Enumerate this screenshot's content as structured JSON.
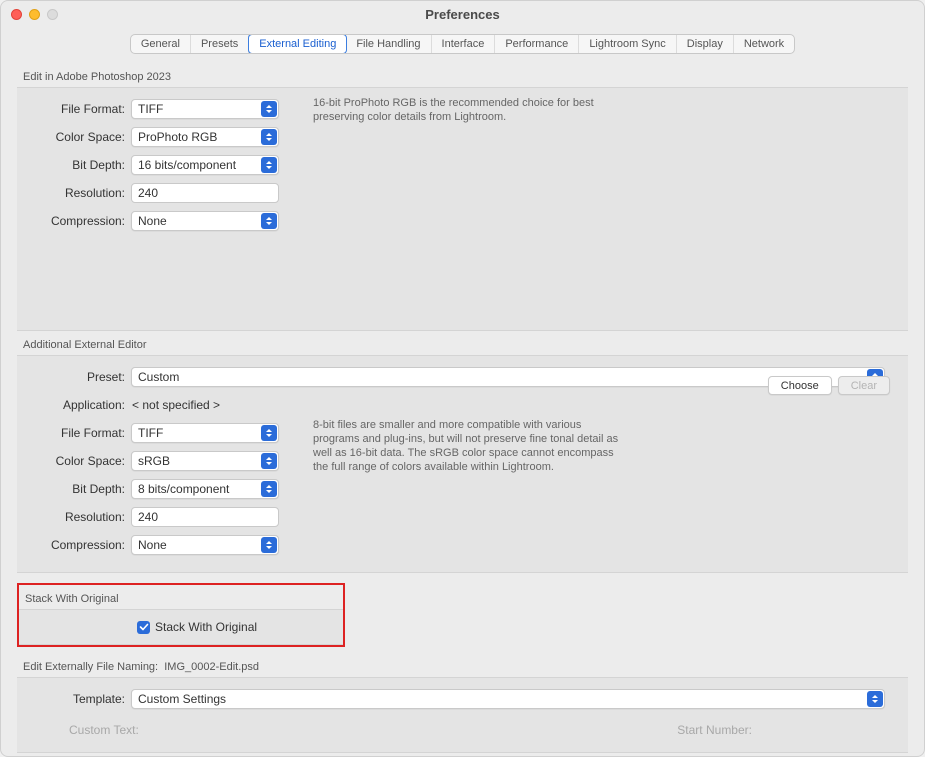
{
  "window": {
    "title": "Preferences"
  },
  "tabs": [
    "General",
    "Presets",
    "External Editing",
    "File Handling",
    "Interface",
    "Performance",
    "Lightroom Sync",
    "Display",
    "Network"
  ],
  "selected_tab_index": 2,
  "section1": {
    "header": "Edit in Adobe Photoshop 2023",
    "file_format": {
      "label": "File Format:",
      "value": "TIFF"
    },
    "color_space": {
      "label": "Color Space:",
      "value": "ProPhoto RGB"
    },
    "bit_depth": {
      "label": "Bit Depth:",
      "value": "16 bits/component"
    },
    "resolution": {
      "label": "Resolution:",
      "value": "240"
    },
    "compression": {
      "label": "Compression:",
      "value": "None"
    },
    "help": "16-bit ProPhoto RGB is the recommended choice for best preserving color details from Lightroom."
  },
  "section2": {
    "header": "Additional External Editor",
    "preset": {
      "label": "Preset:",
      "value": "Custom"
    },
    "application": {
      "label": "Application:",
      "value": "< not specified >"
    },
    "choose_btn": "Choose",
    "clear_btn": "Clear",
    "file_format": {
      "label": "File Format:",
      "value": "TIFF"
    },
    "color_space": {
      "label": "Color Space:",
      "value": "sRGB"
    },
    "bit_depth": {
      "label": "Bit Depth:",
      "value": "8 bits/component"
    },
    "resolution": {
      "label": "Resolution:",
      "value": "240"
    },
    "compression": {
      "label": "Compression:",
      "value": "None"
    },
    "help": "8-bit files are smaller and more compatible with various programs and plug-ins, but will not preserve fine tonal detail as well as 16-bit data. The sRGB color space cannot encompass the full range of colors available within Lightroom."
  },
  "stack": {
    "header": "Stack With Original",
    "checkbox_label": "Stack With Original",
    "checked": true
  },
  "naming": {
    "header_prefix": "Edit Externally File Naming:",
    "header_example": "IMG_0002-Edit.psd",
    "template": {
      "label": "Template:",
      "value": "Custom Settings"
    },
    "custom_text_label": "Custom Text:",
    "start_number_label": "Start Number:"
  }
}
